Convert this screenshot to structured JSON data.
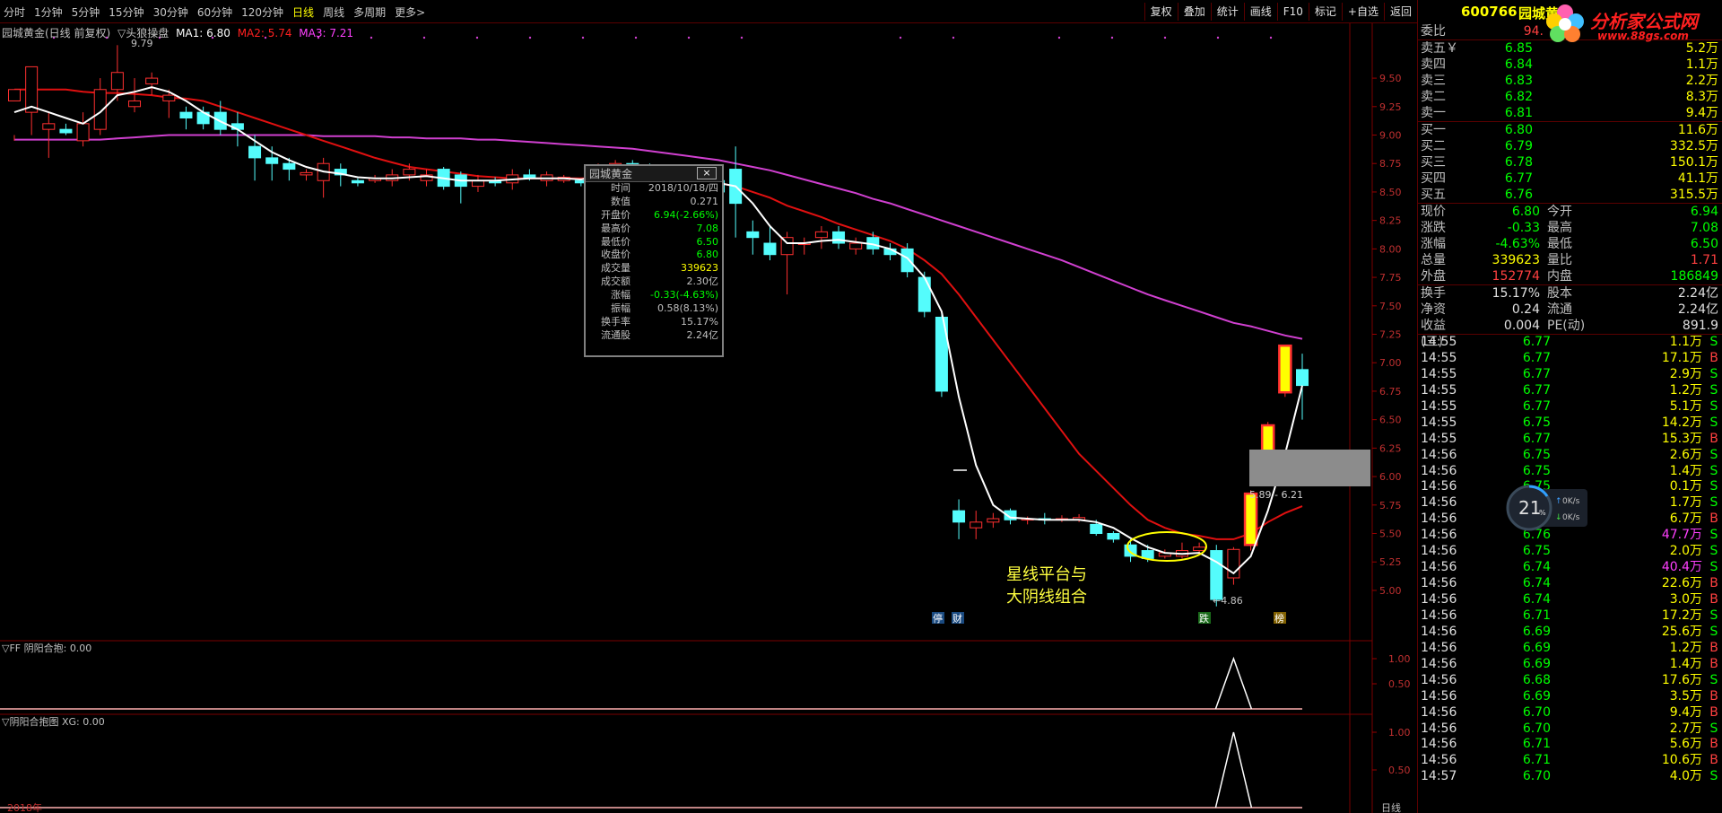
{
  "toolbar": {
    "tabs": [
      "分时",
      "1分钟",
      "5分钟",
      "15分钟",
      "30分钟",
      "60分钟",
      "120分钟",
      "日线",
      "周线",
      "多周期",
      "更多>"
    ],
    "active_tab": "日线",
    "tools": [
      "复权",
      "叠加",
      "统计",
      "画线",
      "F10",
      "标记",
      "+自选",
      "返回"
    ]
  },
  "main_legend": {
    "title": "园城黄金(日线 前复权)",
    "indicator": "▽头狼操盘",
    "ma1": "MA1: 6.80",
    "ma2": "MA2: 5.74",
    "ma3": "MA3: 7.21",
    "ma1_color": "#ffffff",
    "ma2_color": "#ff2020",
    "ma3_color": "#ff40ff"
  },
  "annotations": {
    "high_label": "9.79",
    "low_label": "4.86",
    "range_label": "5.89 - 6.21",
    "text_line1": "星线平台与",
    "text_line2": "大阴线组合",
    "tag_1": "停",
    "tag_2": "财",
    "tag_3": "跌",
    "tag_4": "榜",
    "date_label": "2018年"
  },
  "sub1": {
    "label": "▽FF 阴阳合抱: 0.00",
    "ticks": [
      "1.00",
      "0.50"
    ]
  },
  "sub2": {
    "label": "▽阴阳合抱图 XG: 0.00",
    "ticks": [
      "1.00",
      "0.50"
    ]
  },
  "price_axis": [
    "9.50",
    "9.25",
    "9.00",
    "8.75",
    "8.50",
    "8.25",
    "8.00",
    "7.75",
    "7.50",
    "7.25",
    "7.00",
    "6.75",
    "6.50",
    "6.25",
    "6.00",
    "5.75",
    "5.50",
    "5.25",
    "5.00"
  ],
  "popup": {
    "title": "园城黄金",
    "close": "×",
    "rows": [
      {
        "k": "时间",
        "v": "2018/10/18/四",
        "c": "#c0c0c0"
      },
      {
        "k": "数值",
        "v": "0.271",
        "c": "#c0c0c0"
      },
      {
        "k": "开盘价",
        "v": "6.94(-2.66%)",
        "c": "#00ff00"
      },
      {
        "k": "最高价",
        "v": "7.08",
        "c": "#00ff00"
      },
      {
        "k": "最低价",
        "v": "6.50",
        "c": "#00ff00"
      },
      {
        "k": "收盘价",
        "v": "6.80",
        "c": "#00ff00"
      },
      {
        "k": "成交量",
        "v": "339623",
        "c": "#ffff00"
      },
      {
        "k": "成交额",
        "v": "2.30亿",
        "c": "#c0c0c0"
      },
      {
        "k": "涨幅",
        "v": "-0.33(-4.63%)",
        "c": "#00ff00"
      },
      {
        "k": "振幅",
        "v": "0.58(8.13%)",
        "c": "#c0c0c0"
      },
      {
        "k": "换手率",
        "v": "15.17%",
        "c": "#c0c0c0"
      },
      {
        "k": "流通股",
        "v": "2.24亿",
        "c": "#c0c0c0"
      }
    ]
  },
  "panel": {
    "code": "600766",
    "name": "园城黄",
    "logo_text": "分析家公式网",
    "logo_url": "www.88gs.com",
    "weibi_label": "委比",
    "weibi_value": "94.",
    "asks": [
      {
        "l": "卖五￥",
        "p": "6.85",
        "v": "5.2万"
      },
      {
        "l": "卖四",
        "p": "6.84",
        "v": "1.1万"
      },
      {
        "l": "卖三",
        "p": "6.83",
        "v": "2.2万"
      },
      {
        "l": "卖二",
        "p": "6.82",
        "v": "8.3万"
      },
      {
        "l": "卖一",
        "p": "6.81",
        "v": "9.4万"
      }
    ],
    "bids": [
      {
        "l": "买一",
        "p": "6.80",
        "v": "11.6万"
      },
      {
        "l": "买二",
        "p": "6.79",
        "v": "332.5万"
      },
      {
        "l": "买三",
        "p": "6.78",
        "v": "150.1万"
      },
      {
        "l": "买四",
        "p": "6.77",
        "v": "41.1万"
      },
      {
        "l": "买五",
        "p": "6.76",
        "v": "315.5万"
      }
    ],
    "quote": [
      {
        "l1": "现价",
        "v1": "6.80",
        "c1": "#00ff00",
        "l2": "今开",
        "v2": "6.94",
        "c2": "#00ff00"
      },
      {
        "l1": "涨跌",
        "v1": "-0.33",
        "c1": "#00ff00",
        "l2": "最高",
        "v2": "7.08",
        "c2": "#00ff00"
      },
      {
        "l1": "涨幅",
        "v1": "-4.63%",
        "c1": "#00ff00",
        "l2": "最低",
        "v2": "6.50",
        "c2": "#00ff00"
      },
      {
        "l1": "总量",
        "v1": "339623",
        "c1": "#ffff00",
        "l2": "量比",
        "v2": "1.71",
        "c2": "#ff4040"
      },
      {
        "l1": "外盘",
        "v1": "152774",
        "c1": "#ff4040",
        "l2": "内盘",
        "v2": "186849",
        "c2": "#00ff00"
      }
    ],
    "quote2": [
      {
        "l1": "换手",
        "v1": "15.17%",
        "l2": "股本",
        "v2": "2.24亿"
      },
      {
        "l1": "净资",
        "v1": "0.24",
        "l2": "流通",
        "v2": "2.24亿"
      },
      {
        "l1": "收益(三)",
        "v1": "0.004",
        "l2": "PE(动)",
        "v2": "891.9"
      }
    ],
    "ticks": [
      {
        "t": "14:55",
        "p": "6.77",
        "v": "1.1万",
        "s": "S"
      },
      {
        "t": "14:55",
        "p": "6.77",
        "v": "17.1万",
        "s": "B"
      },
      {
        "t": "14:55",
        "p": "6.77",
        "v": "2.9万",
        "s": "S"
      },
      {
        "t": "14:55",
        "p": "6.77",
        "v": "1.2万",
        "s": "S"
      },
      {
        "t": "14:55",
        "p": "6.77",
        "v": "5.1万",
        "s": "S"
      },
      {
        "t": "14:55",
        "p": "6.75",
        "v": "14.2万",
        "s": "S"
      },
      {
        "t": "14:55",
        "p": "6.77",
        "v": "15.3万",
        "s": "B"
      },
      {
        "t": "14:56",
        "p": "6.75",
        "v": "2.6万",
        "s": "S"
      },
      {
        "t": "14:56",
        "p": "6.75",
        "v": "1.4万",
        "s": "S"
      },
      {
        "t": "14:56",
        "p": "6.75",
        "v": "0.1万",
        "s": "S"
      },
      {
        "t": "14:56",
        "p": "6.76",
        "v": "1.7万",
        "s": "S"
      },
      {
        "t": "14:56",
        "p": "6.77",
        "v": "6.7万",
        "s": "B"
      },
      {
        "t": "14:56",
        "p": "6.76",
        "v": "47.7万",
        "s": "S"
      },
      {
        "t": "14:56",
        "p": "6.75",
        "v": "2.0万",
        "s": "S"
      },
      {
        "t": "14:56",
        "p": "6.74",
        "v": "40.4万",
        "s": "S"
      },
      {
        "t": "14:56",
        "p": "6.74",
        "v": "22.6万",
        "s": "B"
      },
      {
        "t": "14:56",
        "p": "6.74",
        "v": "3.0万",
        "s": "B"
      },
      {
        "t": "14:56",
        "p": "6.71",
        "v": "17.2万",
        "s": "S"
      },
      {
        "t": "14:56",
        "p": "6.69",
        "v": "25.6万",
        "s": "S"
      },
      {
        "t": "14:56",
        "p": "6.69",
        "v": "1.2万",
        "s": "B"
      },
      {
        "t": "14:56",
        "p": "6.69",
        "v": "1.4万",
        "s": "B"
      },
      {
        "t": "14:56",
        "p": "6.68",
        "v": "17.6万",
        "s": "S"
      },
      {
        "t": "14:56",
        "p": "6.69",
        "v": "3.5万",
        "s": "B"
      },
      {
        "t": "14:56",
        "p": "6.70",
        "v": "9.4万",
        "s": "B"
      },
      {
        "t": "14:56",
        "p": "6.70",
        "v": "2.7万",
        "s": "S"
      },
      {
        "t": "14:56",
        "p": "6.71",
        "v": "5.6万",
        "s": "B"
      },
      {
        "t": "14:56",
        "p": "6.71",
        "v": "10.6万",
        "s": "B"
      },
      {
        "t": "14:57",
        "p": "6.70",
        "v": "4.0万",
        "s": "S"
      }
    ],
    "speed": {
      "pct": "21",
      "unit": "%",
      "up": "0K/s",
      "down": "0K/s"
    },
    "bottom_label": "日线"
  },
  "chart_data": {
    "type": "candlestick",
    "ylim": [
      4.7,
      9.95
    ],
    "candles": [
      [
        9.3,
        9.4,
        9.0,
        8.95
      ],
      [
        9.2,
        9.6,
        9.25,
        9.0
      ],
      [
        9.05,
        9.1,
        9.2,
        8.8
      ],
      [
        9.05,
        9.02,
        9.1,
        9.0
      ],
      [
        8.95,
        9.1,
        9.2,
        8.9
      ],
      [
        9.05,
        9.4,
        9.5,
        9.0
      ],
      [
        9.4,
        9.55,
        9.79,
        9.3
      ],
      [
        9.25,
        9.3,
        9.5,
        9.2
      ],
      [
        9.45,
        9.5,
        9.55,
        9.35
      ],
      [
        9.3,
        9.35,
        9.4,
        9.15
      ],
      [
        9.2,
        9.15,
        9.25,
        9.05
      ],
      [
        9.2,
        9.1,
        9.25,
        9.05
      ],
      [
        9.2,
        9.05,
        9.3,
        9.0
      ],
      [
        9.1,
        9.05,
        9.2,
        8.9
      ],
      [
        8.9,
        8.8,
        9.0,
        8.6
      ],
      [
        8.8,
        8.75,
        8.9,
        8.6
      ],
      [
        8.75,
        8.7,
        8.8,
        8.6
      ],
      [
        8.65,
        8.67,
        8.7,
        8.6
      ],
      [
        8.6,
        8.75,
        8.8,
        8.45
      ],
      [
        8.7,
        8.65,
        8.75,
        8.55
      ],
      [
        8.6,
        8.58,
        8.62,
        8.55
      ],
      [
        8.6,
        8.62,
        8.65,
        8.58
      ],
      [
        8.6,
        8.65,
        8.7,
        8.55
      ],
      [
        8.65,
        8.7,
        8.75,
        8.6
      ],
      [
        8.6,
        8.65,
        8.7,
        8.55
      ],
      [
        8.7,
        8.55,
        8.72,
        8.52
      ],
      [
        8.65,
        8.55,
        8.68,
        8.4
      ],
      [
        8.55,
        8.6,
        8.65,
        8.5
      ],
      [
        8.6,
        8.58,
        8.63,
        8.55
      ],
      [
        8.58,
        8.65,
        8.7,
        8.52
      ],
      [
        8.65,
        8.62,
        8.7,
        8.6
      ],
      [
        8.6,
        8.65,
        8.68,
        8.55
      ],
      [
        8.6,
        8.63,
        8.65,
        8.58
      ],
      [
        8.6,
        8.58,
        8.62,
        8.55
      ],
      [
        8.58,
        8.7,
        8.75,
        8.55
      ],
      [
        8.68,
        8.75,
        8.78,
        8.62
      ],
      [
        8.75,
        8.7,
        8.78,
        8.65
      ],
      [
        8.7,
        8.6,
        8.75,
        8.55
      ],
      [
        8.6,
        8.65,
        8.7,
        8.55
      ],
      [
        8.65,
        8.55,
        8.7,
        8.5
      ],
      [
        8.5,
        8.6,
        8.62,
        8.48
      ],
      [
        8.6,
        8.5,
        8.62,
        8.45
      ],
      [
        8.7,
        8.4,
        8.9,
        8.1
      ],
      [
        8.15,
        8.1,
        8.25,
        7.95
      ],
      [
        8.05,
        7.95,
        8.2,
        7.9
      ],
      [
        7.95,
        8.1,
        8.15,
        7.6
      ],
      [
        8.05,
        8.05,
        8.1,
        7.95
      ],
      [
        8.1,
        8.15,
        8.2,
        8.0
      ],
      [
        8.15,
        8.05,
        8.2,
        8.0
      ],
      [
        8.0,
        8.05,
        8.1,
        7.95
      ],
      [
        8.1,
        8.0,
        8.15,
        7.95
      ],
      [
        8.0,
        7.95,
        8.05,
        7.9
      ],
      [
        8.0,
        7.8,
        8.05,
        7.75
      ],
      [
        7.75,
        7.45,
        7.8,
        7.4
      ],
      [
        7.4,
        6.75,
        7.45,
        6.7
      ],
      [
        5.7,
        5.6,
        5.8,
        5.45
      ],
      [
        5.55,
        5.6,
        5.7,
        5.45
      ],
      [
        5.6,
        5.63,
        5.68,
        5.55
      ],
      [
        5.7,
        5.62,
        5.72,
        5.58
      ],
      [
        5.62,
        5.63,
        5.65,
        5.58
      ],
      [
        5.63,
        5.62,
        5.68,
        5.58
      ],
      [
        5.62,
        5.63,
        5.66,
        5.6
      ],
      [
        5.62,
        5.64,
        5.67,
        5.6
      ],
      [
        5.58,
        5.5,
        5.62,
        5.48
      ],
      [
        5.5,
        5.45,
        5.52,
        5.42
      ],
      [
        5.4,
        5.3,
        5.45,
        5.25
      ],
      [
        5.35,
        5.28,
        5.4,
        5.25
      ],
      [
        5.3,
        5.33,
        5.36,
        5.28
      ],
      [
        5.3,
        5.35,
        5.42,
        5.28
      ],
      [
        5.35,
        5.38,
        5.42,
        5.32
      ],
      [
        5.35,
        4.92,
        5.4,
        4.86
      ],
      [
        5.11,
        5.36,
        5.38,
        5.05
      ],
      [
        5.4,
        5.85,
        5.88,
        5.35
      ],
      [
        6.21,
        6.45,
        6.48,
        6.15
      ],
      [
        6.74,
        7.15,
        7.15,
        6.7
      ],
      [
        6.94,
        6.8,
        7.08,
        6.5
      ]
    ],
    "ma1": [
      9.2,
      9.25,
      9.2,
      9.15,
      9.1,
      9.2,
      9.35,
      9.38,
      9.42,
      9.38,
      9.3,
      9.2,
      9.12,
      9.05,
      8.95,
      8.85,
      8.78,
      8.72,
      8.68,
      8.66,
      8.63,
      8.62,
      8.62,
      8.63,
      8.64,
      8.62,
      8.6,
      8.6,
      8.6,
      8.61,
      8.62,
      8.62,
      8.62,
      8.61,
      8.64,
      8.66,
      8.68,
      8.66,
      8.65,
      8.62,
      8.6,
      8.58,
      8.55,
      8.4,
      8.2,
      8.05,
      8.05,
      8.07,
      8.08,
      8.06,
      8.04,
      8.0,
      7.92,
      7.75,
      7.45,
      6.7,
      6.1,
      5.75,
      5.64,
      5.63,
      5.62,
      5.62,
      5.62,
      5.6,
      5.55,
      5.46,
      5.38,
      5.33,
      5.32,
      5.33,
      5.25,
      5.15,
      5.3,
      5.7,
      6.2,
      6.8
    ],
    "ma2": [
      9.4,
      9.4,
      9.4,
      9.4,
      9.38,
      9.37,
      9.37,
      9.36,
      9.35,
      9.33,
      9.32,
      9.3,
      9.25,
      9.2,
      9.15,
      9.1,
      9.05,
      9.0,
      8.95,
      8.9,
      8.85,
      8.8,
      8.76,
      8.72,
      8.7,
      8.68,
      8.66,
      8.64,
      8.63,
      8.62,
      8.62,
      8.62,
      8.62,
      8.62,
      8.62,
      8.62,
      8.62,
      8.62,
      8.62,
      8.61,
      8.6,
      8.58,
      8.55,
      8.5,
      8.45,
      8.38,
      8.33,
      8.28,
      8.22,
      8.17,
      8.12,
      8.07,
      8.0,
      7.9,
      7.78,
      7.6,
      7.4,
      7.2,
      7.0,
      6.8,
      6.6,
      6.4,
      6.2,
      6.05,
      5.9,
      5.75,
      5.62,
      5.55,
      5.5,
      5.48,
      5.45,
      5.45,
      5.5,
      5.6,
      5.68,
      5.74
    ],
    "ma3": [
      8.96,
      8.96,
      8.96,
      8.96,
      8.96,
      8.96,
      8.97,
      8.98,
      8.99,
      9.0,
      9.0,
      9.0,
      9.0,
      9.0,
      9.0,
      9.0,
      9.0,
      9.0,
      8.99,
      8.99,
      8.99,
      8.99,
      8.98,
      8.98,
      8.97,
      8.97,
      8.97,
      8.96,
      8.96,
      8.95,
      8.94,
      8.93,
      8.92,
      8.91,
      8.9,
      8.89,
      8.88,
      8.86,
      8.84,
      8.82,
      8.8,
      8.78,
      8.75,
      8.72,
      8.69,
      8.65,
      8.61,
      8.57,
      8.53,
      8.49,
      8.44,
      8.4,
      8.35,
      8.3,
      8.25,
      8.2,
      8.15,
      8.1,
      8.05,
      8.0,
      7.95,
      7.9,
      7.84,
      7.78,
      7.72,
      7.66,
      7.6,
      7.55,
      7.5,
      7.45,
      7.4,
      7.35,
      7.32,
      7.28,
      7.24,
      7.21
    ]
  }
}
